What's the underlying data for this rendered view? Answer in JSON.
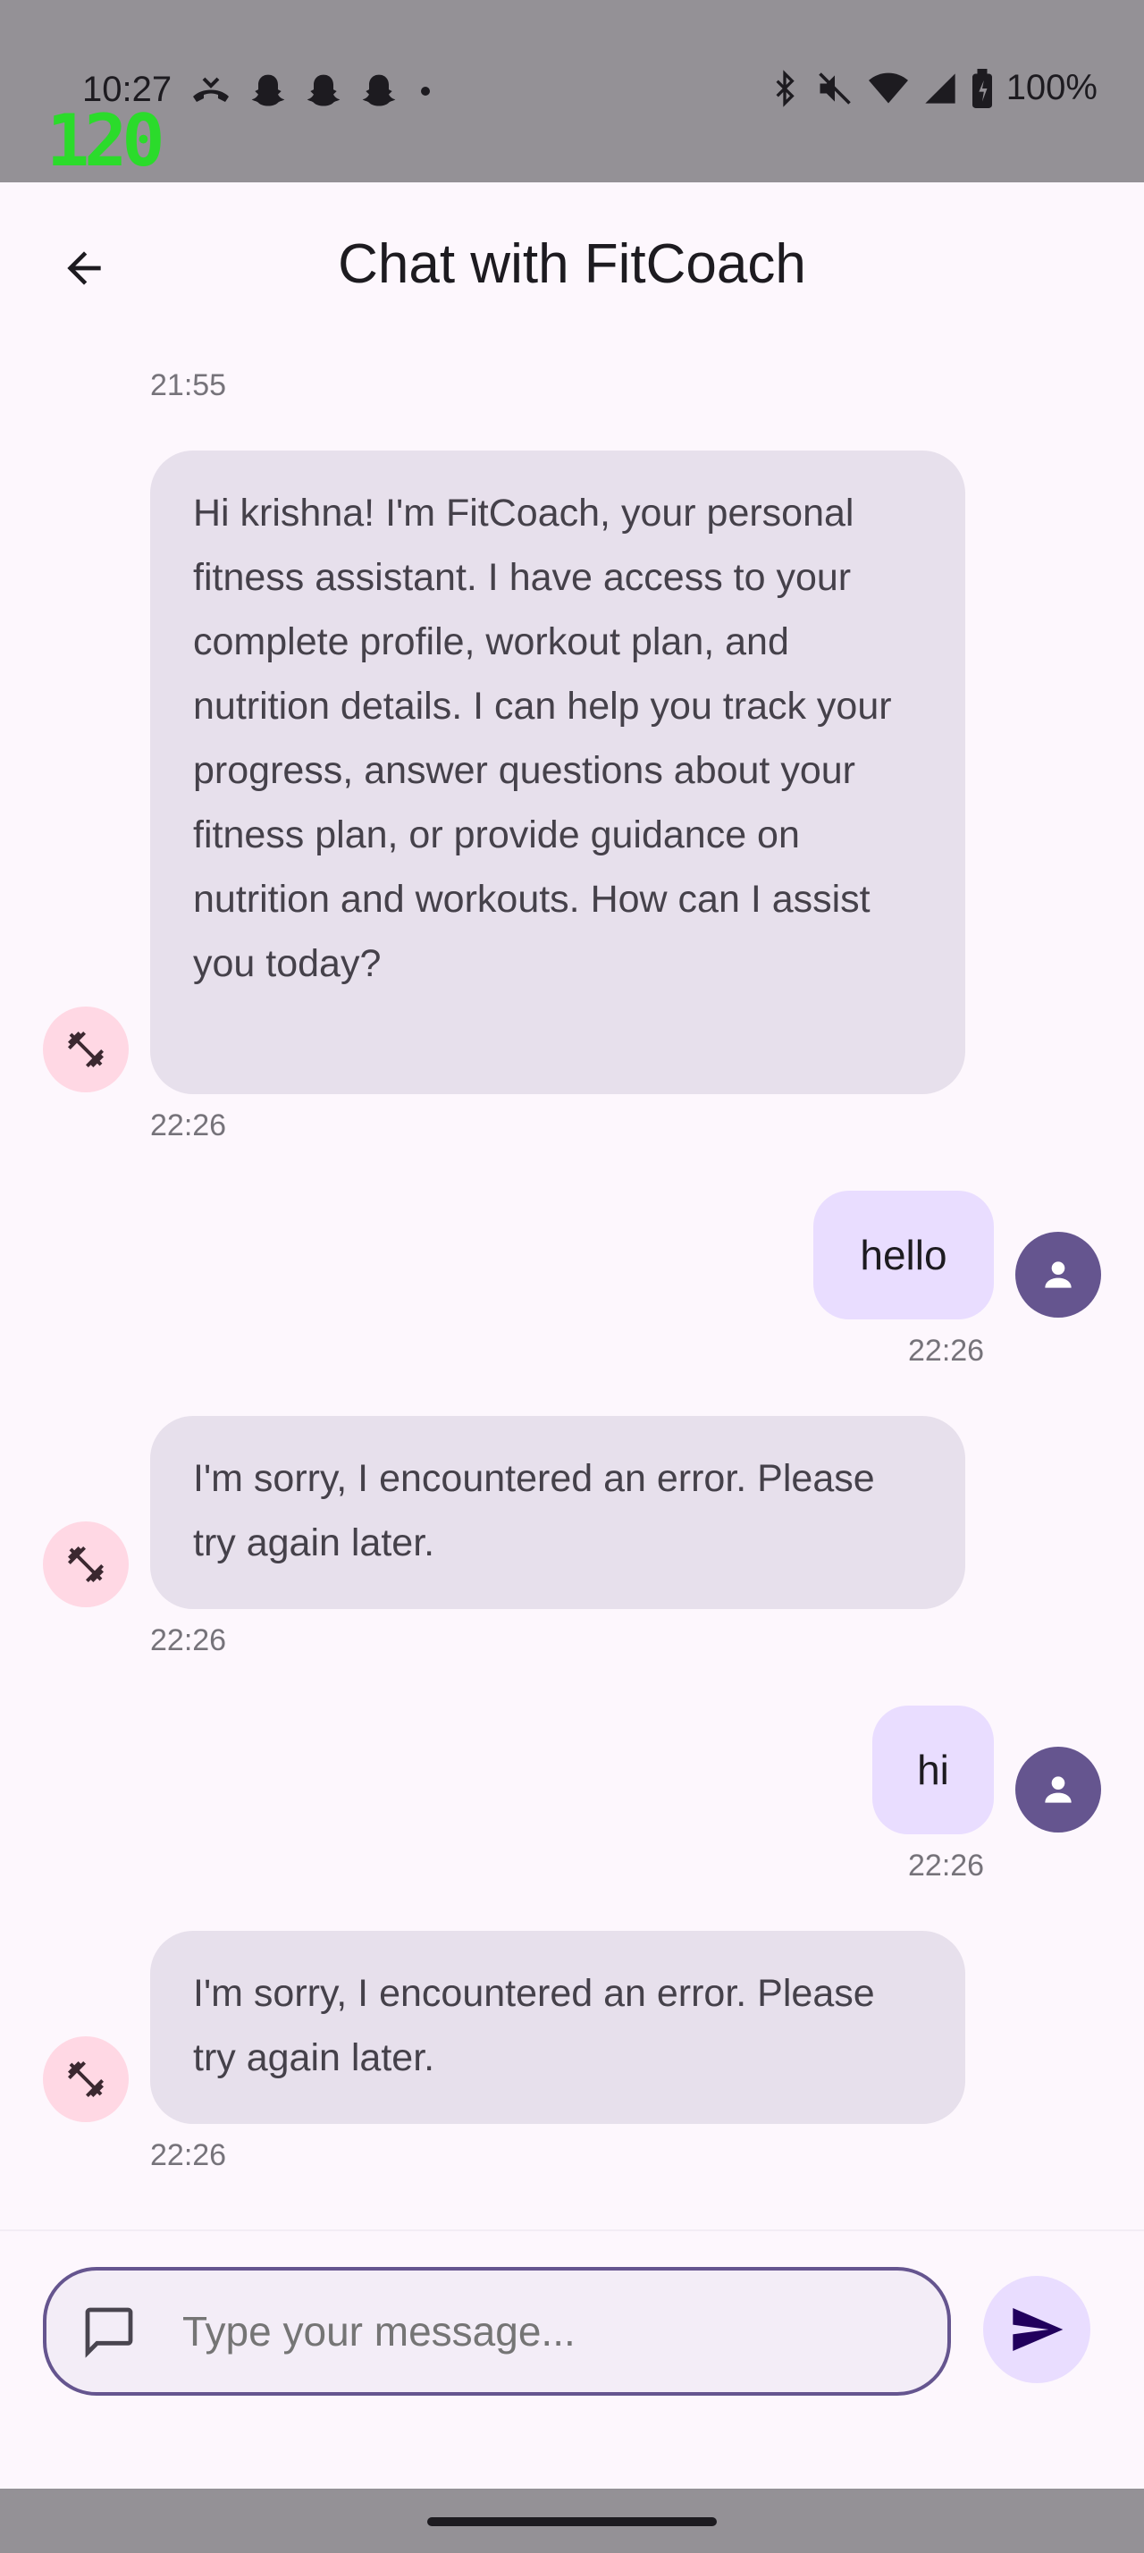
{
  "status_bar": {
    "time": "10:27",
    "battery": "100%",
    "fps": "120",
    "left_icons": [
      "missed-call-icon",
      "snapchat-icon",
      "snapchat-icon",
      "snapchat-icon",
      "dot-icon"
    ],
    "right_icons": [
      "bluetooth-icon",
      "mute-icon",
      "wifi-icon",
      "signal-icon",
      "battery-icon"
    ]
  },
  "app_bar": {
    "title": "Chat with FitCoach",
    "back_icon": "arrow-back-icon"
  },
  "messages": [
    {
      "sender": "bot",
      "timestamp_above": "21:55",
      "text": "Hi krishna! I'm FitCoach, your personal fitness assistant. I have access to your complete profile, workout plan, and nutrition details. I can help you track your progress, answer questions about your fitness plan, or provide guidance on nutrition and workouts. How can I assist you today?",
      "timestamp": "22:26",
      "avatar_icon": "dumbbell-icon"
    },
    {
      "sender": "user",
      "text": "hello",
      "timestamp": "22:26",
      "avatar_icon": "person-icon"
    },
    {
      "sender": "bot",
      "text": "I'm sorry, I encountered an error. Please try again later.",
      "timestamp": "22:26",
      "avatar_icon": "dumbbell-icon"
    },
    {
      "sender": "user",
      "text": "hi",
      "timestamp": "22:26",
      "avatar_icon": "person-icon"
    },
    {
      "sender": "bot",
      "text": "I'm sorry, I encountered an error. Please try again later.",
      "timestamp": "22:26",
      "avatar_icon": "dumbbell-icon"
    }
  ],
  "input": {
    "placeholder": "Type your message...",
    "value": "",
    "leading_icon": "chat-bubble-icon",
    "send_icon": "send-icon"
  },
  "colors": {
    "primary": "#65558f",
    "bot_bubble": "#e7e0ec",
    "user_bubble": "#e9ddff",
    "bot_avatar": "#ffd8e4",
    "background": "#fdf7fd"
  }
}
